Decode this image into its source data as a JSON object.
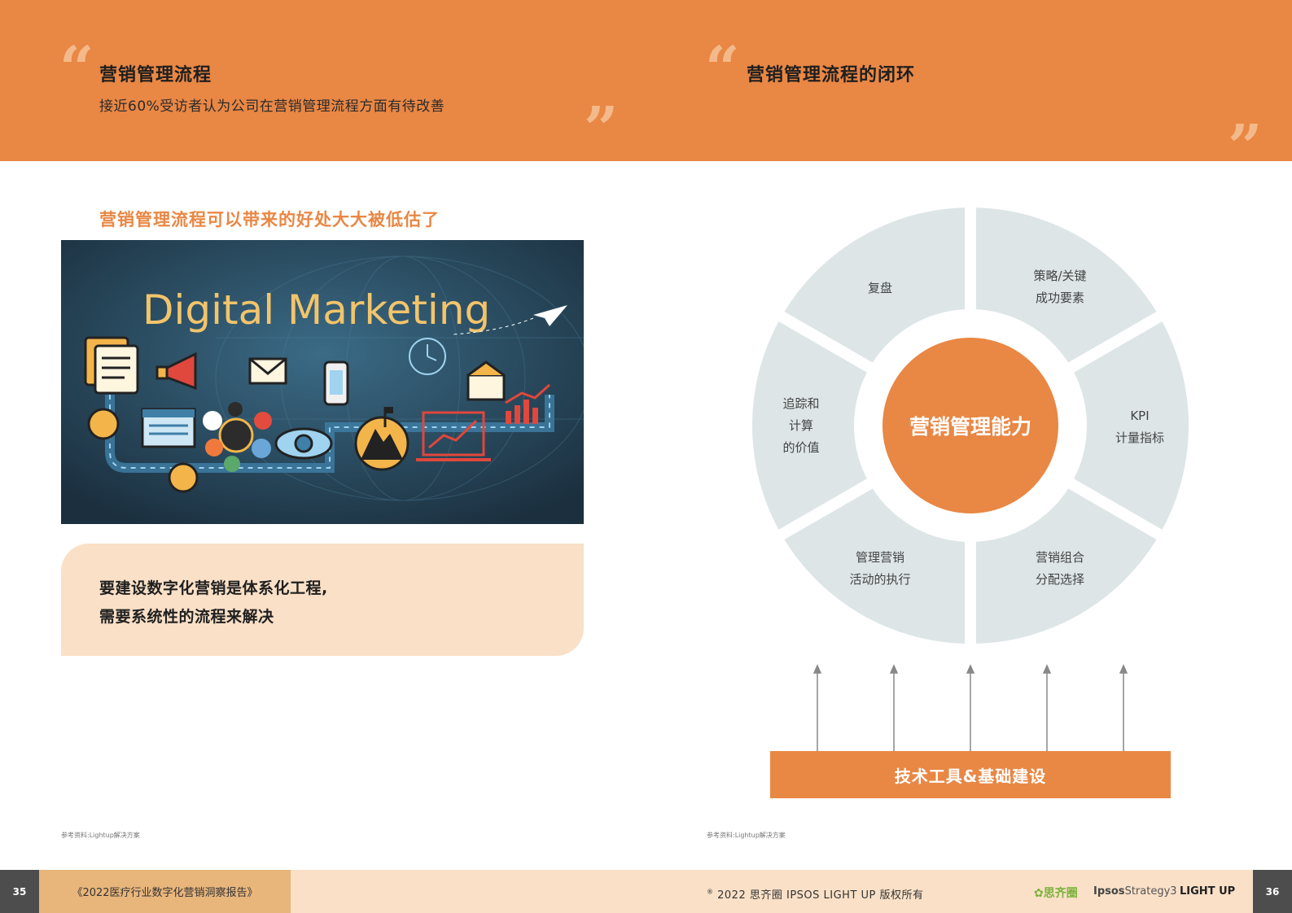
{
  "left_page": {
    "header_title": "营销管理流程",
    "header_subtitle": "接近60%受访者认为公司在营销管理流程方面有待改善",
    "section_title": "营销管理流程可以带来的好处大大被低估了",
    "image_title": "Digital Marketing",
    "callout_line1": "要建设数字化营销是体系化工程,",
    "callout_line2": "需要系统性的流程来解决",
    "reference": "参考资料:Lightup解决方案",
    "page_number": "35"
  },
  "right_page": {
    "header_title": "营销管理流程的闭环",
    "wheel_center": "营销管理能力",
    "segments": [
      {
        "line1": "复盘",
        "line2": "",
        "line3": ""
      },
      {
        "line1": "策略/关键",
        "line2": "成功要素",
        "line3": ""
      },
      {
        "line1": "KPI",
        "line2": "计量指标",
        "line3": ""
      },
      {
        "line1": "营销组合",
        "line2": "分配选择",
        "line3": ""
      },
      {
        "line1": "管理营销",
        "line2": "活动的执行",
        "line3": ""
      },
      {
        "line1": "追踪和",
        "line2": "计算",
        "line3": "的价值"
      }
    ],
    "base_label": "技术工具&基础建设",
    "reference": "参考资料:Lightup解决方案",
    "page_number": "36"
  },
  "footer": {
    "publication": "《2022医疗行业数字化营销洞察报告》",
    "copyright": "2022 思齐圈 IPSOS LIGHT UP 版权所有",
    "copyright_mark": "®",
    "logo_siqiquan": "思齐圈",
    "logo_ipsos_bold": "Ipsos",
    "logo_ipsos_rest": "Strategy3",
    "logo_lightup": "LIGHT UP"
  },
  "colors": {
    "accent_orange": "#e98744",
    "light_peach": "#f9e0c7",
    "segment_gray": "#dde5e7",
    "dark_gray": "#4d4d4d"
  }
}
